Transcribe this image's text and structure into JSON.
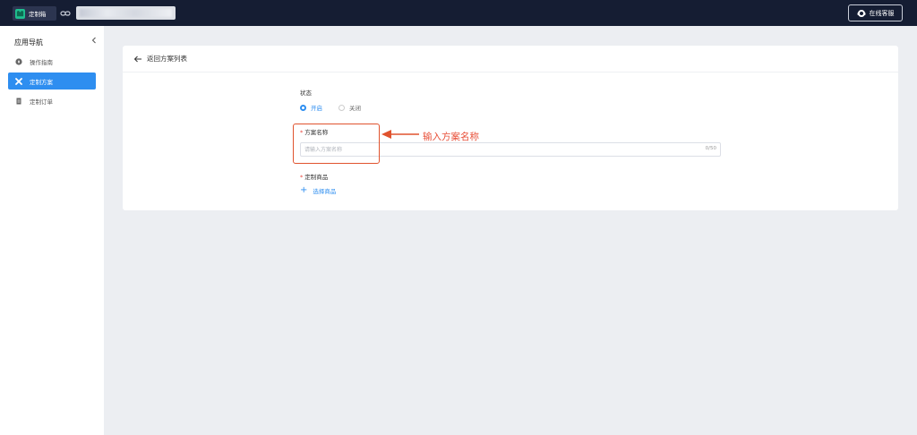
{
  "topbar": {
    "app_name": "定制箱",
    "service_label": "在线客服",
    "icons": {
      "logo": "app-logo-icon",
      "link": "link-icon",
      "service": "headset-icon"
    }
  },
  "sidebar": {
    "title": "应用导航",
    "items": [
      {
        "label": "操作指南",
        "icon": "compass-icon",
        "active": false
      },
      {
        "label": "定制方案",
        "icon": "tools-icon",
        "active": true
      },
      {
        "label": "定制订单",
        "icon": "document-icon",
        "active": false
      }
    ]
  },
  "main": {
    "back_label": "返回方案列表",
    "status": {
      "label": "状态",
      "options": [
        "开启",
        "关闭"
      ],
      "selected": "开启"
    },
    "plan_name": {
      "required_mark": "*",
      "label": "方案名称",
      "placeholder": "请输入方案名称",
      "value": "",
      "counter": "0/50"
    },
    "goods": {
      "required_mark": "*",
      "label": "定制商品",
      "action_label": "选择商品"
    }
  },
  "annotation": {
    "text": "输入方案名称",
    "color": "#e0532e"
  },
  "colors": {
    "topbar_bg": "#151d33",
    "accent": "#2e8ef0",
    "page_bg": "#eceef2",
    "required": "#e8453c"
  }
}
